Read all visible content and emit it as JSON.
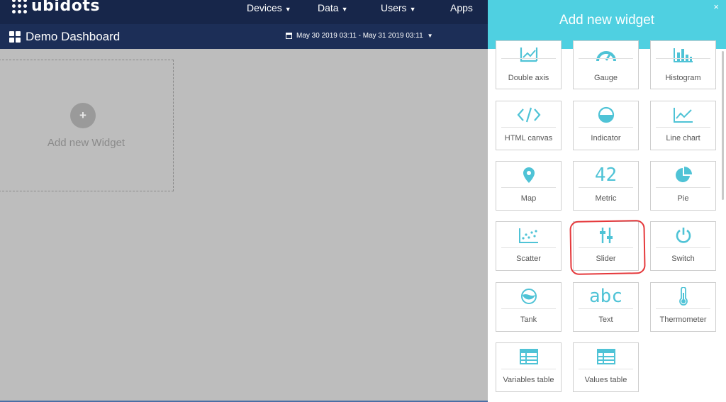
{
  "app": {
    "logo_text": "ubidots"
  },
  "nav": [
    {
      "label": "Devices",
      "has_caret": true
    },
    {
      "label": "Data",
      "has_caret": true
    },
    {
      "label": "Users",
      "has_caret": true
    },
    {
      "label": "Apps",
      "has_caret": false
    }
  ],
  "dashboard": {
    "title": "Demo Dashboard",
    "date_range": "May 30 2019 03:11 - May 31 2019 03:11"
  },
  "canvas": {
    "add_widget_label": "Add new Widget",
    "plus_symbol": "+"
  },
  "panel": {
    "title": "Add new widget",
    "close_symbol": "×",
    "widgets": [
      {
        "label": "Double axis",
        "icon": "double-axis-icon"
      },
      {
        "label": "Gauge",
        "icon": "gauge-icon"
      },
      {
        "label": "Histogram",
        "icon": "histogram-icon"
      },
      {
        "label": "HTML canvas",
        "icon": "code-icon"
      },
      {
        "label": "Indicator",
        "icon": "indicator-icon"
      },
      {
        "label": "Line chart",
        "icon": "line-chart-icon"
      },
      {
        "label": "Map",
        "icon": "map-pin-icon"
      },
      {
        "label": "Metric",
        "icon": "metric-icon",
        "icon_text": "42"
      },
      {
        "label": "Pie",
        "icon": "pie-icon"
      },
      {
        "label": "Scatter",
        "icon": "scatter-icon"
      },
      {
        "label": "Slider",
        "icon": "slider-icon"
      },
      {
        "label": "Switch",
        "icon": "power-icon"
      },
      {
        "label": "Tank",
        "icon": "tank-icon"
      },
      {
        "label": "Text",
        "icon": "text-icon",
        "icon_text": "abc"
      },
      {
        "label": "Thermometer",
        "icon": "thermometer-icon"
      },
      {
        "label": "Variables table",
        "icon": "table-icon"
      },
      {
        "label": "Values table",
        "icon": "table-icon"
      }
    ]
  },
  "colors": {
    "accent": "#4fd0e1",
    "navbar": "#17264a",
    "subbar": "#1c2e57",
    "icon": "#4fc3d6",
    "annotation": "#e5383b"
  }
}
